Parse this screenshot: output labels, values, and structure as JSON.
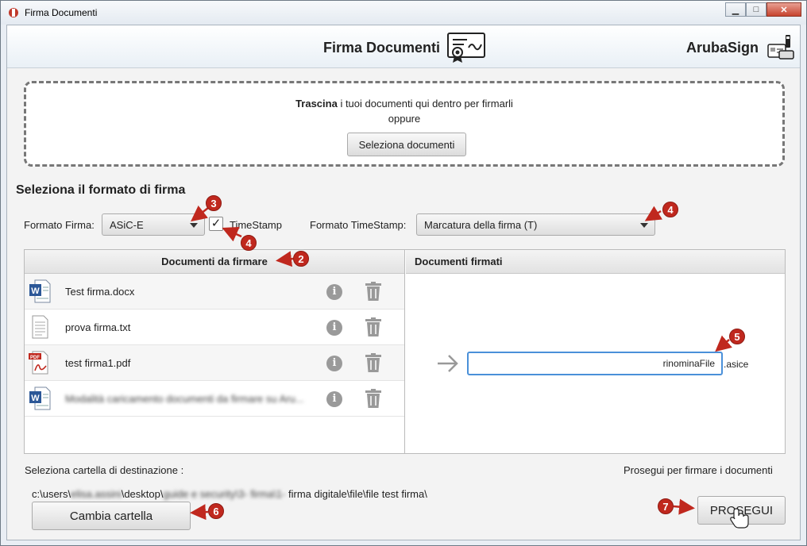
{
  "window": {
    "title": "Firma Documenti",
    "minimize": "▁",
    "maximize": "□",
    "close": "✕"
  },
  "header": {
    "title": "Firma Documenti",
    "brand": "ArubaSign"
  },
  "dropzone": {
    "bold": "Trascina",
    "text": " i tuoi documenti qui dentro per firmarli",
    "or": "oppure",
    "button": "Seleziona documenti"
  },
  "format": {
    "section_title": "Seleziona il formato di firma",
    "label": "Formato Firma:",
    "value": "ASiC-E",
    "timestamp_checked": true,
    "timestamp_check_glyph": "✓",
    "timestamp_label": "TimeStamp",
    "ts_format_label": "Formato TimeStamp:",
    "ts_format_value": "Marcatura della firma (T)"
  },
  "documents": {
    "to_sign_header": "Documenti da firmare",
    "signed_header": "Documenti firmati",
    "items": [
      {
        "name": "Test firma.docx",
        "icon": "word-doc-icon"
      },
      {
        "name": "prova firma.txt",
        "icon": "text-file-icon"
      },
      {
        "name": "test firma1.pdf",
        "icon": "pdf-file-icon"
      },
      {
        "name": "Modalità caricamento documenti da firmare su Aru...",
        "icon": "word-doc-icon"
      }
    ],
    "info_glyph": "i"
  },
  "output": {
    "filename": "rinominaFile",
    "extension": ".asice"
  },
  "destination": {
    "label": "Seleziona cartella di destinazione :",
    "path_prefix": "c:\\users\\",
    "path_user": "elisa.assini",
    "path_mid": "\\desktop\\",
    "path_blur2": "guide e security\\3- firma\\1-",
    "path_suffix": " firma digitale\\file\\file test firma\\",
    "change_button": "Cambia cartella"
  },
  "proceed": {
    "label": "Prosegui per firmare i documenti",
    "button": "PROSEGUI"
  },
  "annotations": {
    "b3": "3",
    "b4a": "4",
    "b4b": "4",
    "b2": "2",
    "b5": "5",
    "b6": "6",
    "b7": "7",
    "color": "#c0281e"
  }
}
